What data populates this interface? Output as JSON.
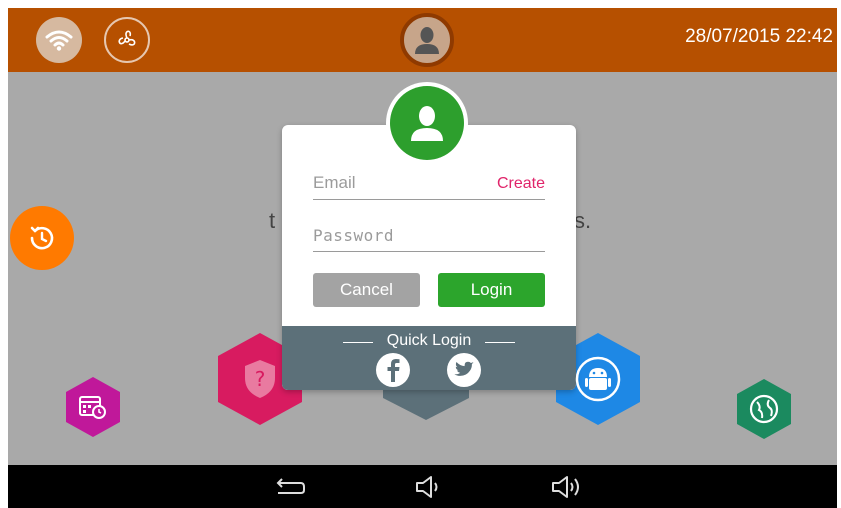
{
  "status_bar": {
    "datetime": "28/07/2015 22:42",
    "icons": [
      "wifi-icon",
      "fan-icon",
      "user-icon"
    ]
  },
  "background": {
    "text_left": "t",
    "text_right": "s."
  },
  "side_button": {
    "icon": "refresh-clock-icon",
    "color": "#ff7a00"
  },
  "app_icons": [
    {
      "name": "calendar-clock-icon",
      "color": "#c0189a"
    },
    {
      "name": "shield-question-icon",
      "color": "#d81b60"
    },
    {
      "name": "android-icon",
      "color": "#1e88e5"
    },
    {
      "name": "globe-person-icon",
      "color": "#1b8a5f"
    }
  ],
  "login_dialog": {
    "email_placeholder": "Email",
    "create_link": "Create",
    "password_placeholder": "Password",
    "cancel_label": "Cancel",
    "login_label": "Login",
    "quick_login_label": "Quick Login",
    "social": [
      "facebook-icon",
      "twitter-icon"
    ]
  },
  "nav_bar": {
    "icons": [
      "back-icon",
      "volume-down-icon",
      "volume-up-icon"
    ]
  },
  "colors": {
    "top_bar": "#b65000",
    "primary_green": "#2ca52c",
    "link_pink": "#e0246a",
    "quick_login_bg": "#5c7079"
  }
}
